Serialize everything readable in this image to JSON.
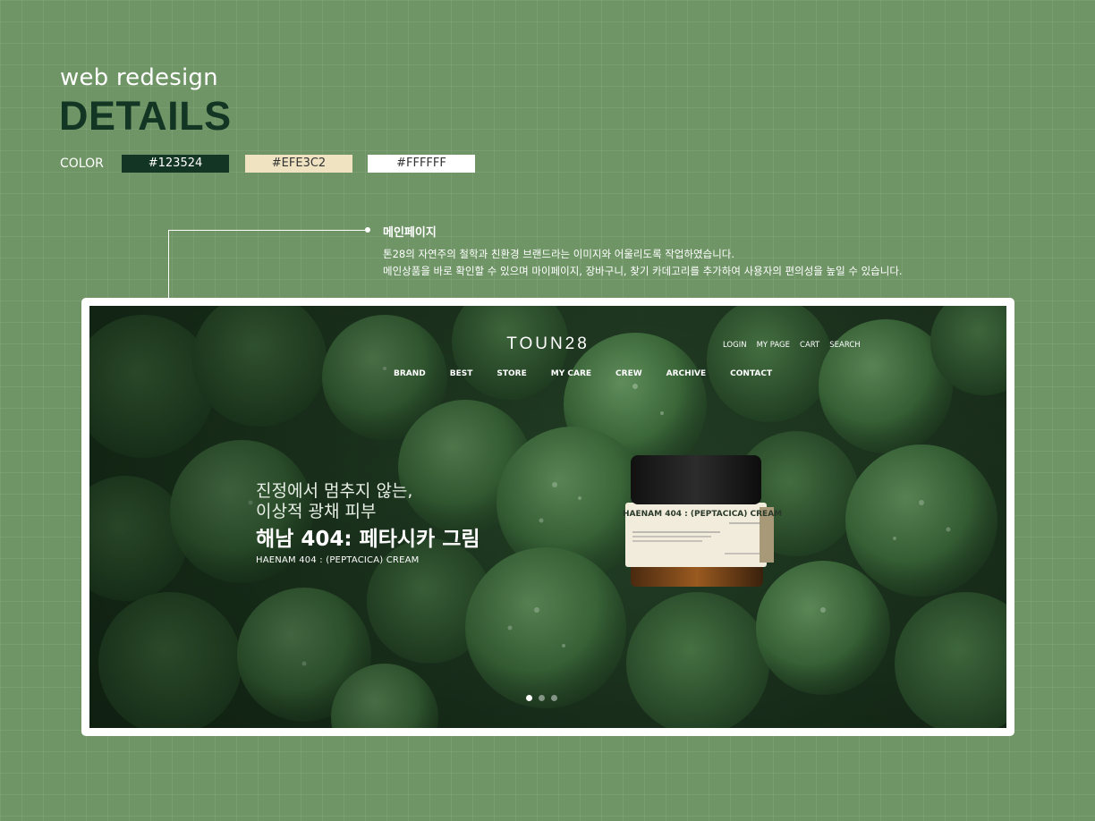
{
  "header": {
    "subtitle": "web redesign",
    "title": "DETAILS"
  },
  "palette": {
    "label": "COLOR",
    "swatches": [
      {
        "hex": "#123524",
        "label": "#123524"
      },
      {
        "hex": "#EFE3C2",
        "label": "#EFE3C2"
      },
      {
        "hex": "#FFFFFF",
        "label": "#FFFFFF"
      }
    ]
  },
  "annotation": {
    "title": "메인페이지",
    "lines": [
      "톤28의 자연주의 철학과 친환경 브랜드라는 이미지와 어울리도록 작업하였습니다.",
      "메인상품을 바로 확인할 수 있으며 마이페이지, 장바구니, 찾기 카데고리를 추가하여 사용자의 편의성을 높일 수 있습니다."
    ]
  },
  "site": {
    "logo": "TOUN28",
    "util_nav": [
      "LOGIN",
      "MY PAGE",
      "CART",
      "SEARCH"
    ],
    "main_nav": [
      "BRAND",
      "BEST",
      "STORE",
      "MY CARE",
      "CREW",
      "ARCHIVE",
      "CONTACT"
    ],
    "hero": {
      "line1": "진정에서 멈추지 않는,",
      "line2": "이상적 광채 피부",
      "product": "해남 404: 페타시카 그림",
      "product_en": "HAENAM 404 : (PEPTACICA) CREAM"
    },
    "jar_label": "HAENAM 404 : (PEPTACICA) CREAM",
    "slider": {
      "count": 3,
      "active": 1
    }
  }
}
